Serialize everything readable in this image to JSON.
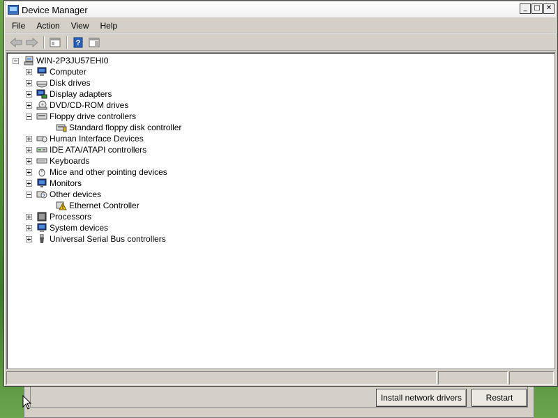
{
  "window": {
    "title": "Device Manager"
  },
  "controls": {
    "minimize": "_",
    "maximize": "□",
    "close": "✕"
  },
  "menu": [
    "File",
    "Action",
    "View",
    "Help"
  ],
  "toolbar_icons": [
    "back-arrow-icon",
    "forward-arrow-icon",
    "properties-pane-icon",
    "help-icon",
    "show-hide-pane-icon"
  ],
  "tree": {
    "root": {
      "label": "WIN-2P3JU57EHI0",
      "icon": "computer-network-icon",
      "expanded": true
    },
    "items": [
      {
        "label": "Computer",
        "icon": "computer-icon",
        "expanded": false,
        "level": 1
      },
      {
        "label": "Disk drives",
        "icon": "disk-drive-icon",
        "expanded": false,
        "level": 1
      },
      {
        "label": "Display adapters",
        "icon": "display-adapter-icon",
        "expanded": false,
        "level": 1
      },
      {
        "label": "DVD/CD-ROM drives",
        "icon": "dvd-drive-icon",
        "expanded": false,
        "level": 1
      },
      {
        "label": "Floppy drive controllers",
        "icon": "floppy-controller-icon",
        "expanded": true,
        "level": 1
      },
      {
        "label": "Standard floppy disk controller",
        "icon": "floppy-controller-icon",
        "level": 2
      },
      {
        "label": "Human Interface Devices",
        "icon": "hid-icon",
        "expanded": false,
        "level": 1
      },
      {
        "label": "IDE ATA/ATAPI controllers",
        "icon": "ide-controller-icon",
        "expanded": false,
        "level": 1
      },
      {
        "label": "Keyboards",
        "icon": "keyboard-icon",
        "expanded": false,
        "level": 1
      },
      {
        "label": "Mice and other pointing devices",
        "icon": "mouse-icon",
        "expanded": false,
        "level": 1
      },
      {
        "label": "Monitors",
        "icon": "monitor-icon",
        "expanded": false,
        "level": 1
      },
      {
        "label": "Other devices",
        "icon": "unknown-device-icon",
        "expanded": true,
        "level": 1
      },
      {
        "label": "Ethernet Controller",
        "icon": "warning-device-icon",
        "level": 2
      },
      {
        "label": "Processors",
        "icon": "processor-icon",
        "expanded": false,
        "level": 1
      },
      {
        "label": "System devices",
        "icon": "system-device-icon",
        "expanded": false,
        "level": 1
      },
      {
        "label": "Universal Serial Bus controllers",
        "icon": "usb-icon",
        "expanded": false,
        "level": 1
      }
    ]
  },
  "background_dialog": {
    "buttons": {
      "install": "Install network drivers",
      "restart": "Restart"
    }
  }
}
